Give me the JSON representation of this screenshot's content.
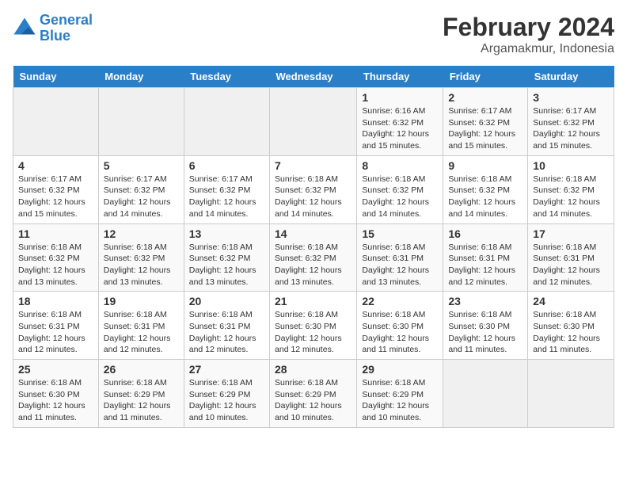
{
  "header": {
    "logo_line1": "General",
    "logo_line2": "Blue",
    "title": "February 2024",
    "subtitle": "Argamakmur, Indonesia"
  },
  "weekdays": [
    "Sunday",
    "Monday",
    "Tuesday",
    "Wednesday",
    "Thursday",
    "Friday",
    "Saturday"
  ],
  "weeks": [
    [
      {
        "day": "",
        "info": ""
      },
      {
        "day": "",
        "info": ""
      },
      {
        "day": "",
        "info": ""
      },
      {
        "day": "",
        "info": ""
      },
      {
        "day": "1",
        "info": "Sunrise: 6:16 AM\nSunset: 6:32 PM\nDaylight: 12 hours and 15 minutes."
      },
      {
        "day": "2",
        "info": "Sunrise: 6:17 AM\nSunset: 6:32 PM\nDaylight: 12 hours and 15 minutes."
      },
      {
        "day": "3",
        "info": "Sunrise: 6:17 AM\nSunset: 6:32 PM\nDaylight: 12 hours and 15 minutes."
      }
    ],
    [
      {
        "day": "4",
        "info": "Sunrise: 6:17 AM\nSunset: 6:32 PM\nDaylight: 12 hours and 15 minutes."
      },
      {
        "day": "5",
        "info": "Sunrise: 6:17 AM\nSunset: 6:32 PM\nDaylight: 12 hours and 14 minutes."
      },
      {
        "day": "6",
        "info": "Sunrise: 6:17 AM\nSunset: 6:32 PM\nDaylight: 12 hours and 14 minutes."
      },
      {
        "day": "7",
        "info": "Sunrise: 6:18 AM\nSunset: 6:32 PM\nDaylight: 12 hours and 14 minutes."
      },
      {
        "day": "8",
        "info": "Sunrise: 6:18 AM\nSunset: 6:32 PM\nDaylight: 12 hours and 14 minutes."
      },
      {
        "day": "9",
        "info": "Sunrise: 6:18 AM\nSunset: 6:32 PM\nDaylight: 12 hours and 14 minutes."
      },
      {
        "day": "10",
        "info": "Sunrise: 6:18 AM\nSunset: 6:32 PM\nDaylight: 12 hours and 14 minutes."
      }
    ],
    [
      {
        "day": "11",
        "info": "Sunrise: 6:18 AM\nSunset: 6:32 PM\nDaylight: 12 hours and 13 minutes."
      },
      {
        "day": "12",
        "info": "Sunrise: 6:18 AM\nSunset: 6:32 PM\nDaylight: 12 hours and 13 minutes."
      },
      {
        "day": "13",
        "info": "Sunrise: 6:18 AM\nSunset: 6:32 PM\nDaylight: 12 hours and 13 minutes."
      },
      {
        "day": "14",
        "info": "Sunrise: 6:18 AM\nSunset: 6:32 PM\nDaylight: 12 hours and 13 minutes."
      },
      {
        "day": "15",
        "info": "Sunrise: 6:18 AM\nSunset: 6:31 PM\nDaylight: 12 hours and 13 minutes."
      },
      {
        "day": "16",
        "info": "Sunrise: 6:18 AM\nSunset: 6:31 PM\nDaylight: 12 hours and 12 minutes."
      },
      {
        "day": "17",
        "info": "Sunrise: 6:18 AM\nSunset: 6:31 PM\nDaylight: 12 hours and 12 minutes."
      }
    ],
    [
      {
        "day": "18",
        "info": "Sunrise: 6:18 AM\nSunset: 6:31 PM\nDaylight: 12 hours and 12 minutes."
      },
      {
        "day": "19",
        "info": "Sunrise: 6:18 AM\nSunset: 6:31 PM\nDaylight: 12 hours and 12 minutes."
      },
      {
        "day": "20",
        "info": "Sunrise: 6:18 AM\nSunset: 6:31 PM\nDaylight: 12 hours and 12 minutes."
      },
      {
        "day": "21",
        "info": "Sunrise: 6:18 AM\nSunset: 6:30 PM\nDaylight: 12 hours and 12 minutes."
      },
      {
        "day": "22",
        "info": "Sunrise: 6:18 AM\nSunset: 6:30 PM\nDaylight: 12 hours and 11 minutes."
      },
      {
        "day": "23",
        "info": "Sunrise: 6:18 AM\nSunset: 6:30 PM\nDaylight: 12 hours and 11 minutes."
      },
      {
        "day": "24",
        "info": "Sunrise: 6:18 AM\nSunset: 6:30 PM\nDaylight: 12 hours and 11 minutes."
      }
    ],
    [
      {
        "day": "25",
        "info": "Sunrise: 6:18 AM\nSunset: 6:30 PM\nDaylight: 12 hours and 11 minutes."
      },
      {
        "day": "26",
        "info": "Sunrise: 6:18 AM\nSunset: 6:29 PM\nDaylight: 12 hours and 11 minutes."
      },
      {
        "day": "27",
        "info": "Sunrise: 6:18 AM\nSunset: 6:29 PM\nDaylight: 12 hours and 10 minutes."
      },
      {
        "day": "28",
        "info": "Sunrise: 6:18 AM\nSunset: 6:29 PM\nDaylight: 12 hours and 10 minutes."
      },
      {
        "day": "29",
        "info": "Sunrise: 6:18 AM\nSunset: 6:29 PM\nDaylight: 12 hours and 10 minutes."
      },
      {
        "day": "",
        "info": ""
      },
      {
        "day": "",
        "info": ""
      }
    ]
  ]
}
